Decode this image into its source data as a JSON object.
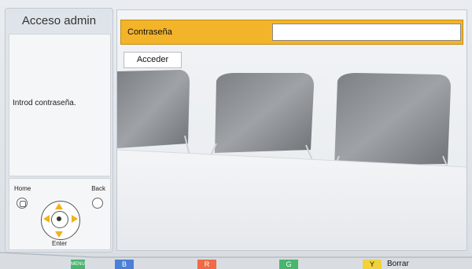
{
  "left_panel": {
    "title": "Acceso admin",
    "message": "Introd contraseña.",
    "remote": {
      "home_label": "Home",
      "back_label": "Back",
      "enter_label": "Enter"
    }
  },
  "password": {
    "label": "Contraseña",
    "value": ""
  },
  "login_button": "Acceder",
  "footer": {
    "menu_key": "MENU",
    "b_key": "B",
    "r_key": "R",
    "g_key": "G",
    "y_key": "Y",
    "y_label": "Borrar"
  },
  "colors": {
    "accent_orange": "#f3b42a",
    "key_green": "#49b56d",
    "key_blue": "#4c7fd6",
    "key_red": "#f06a47",
    "key_yellow": "#f0d33a"
  }
}
